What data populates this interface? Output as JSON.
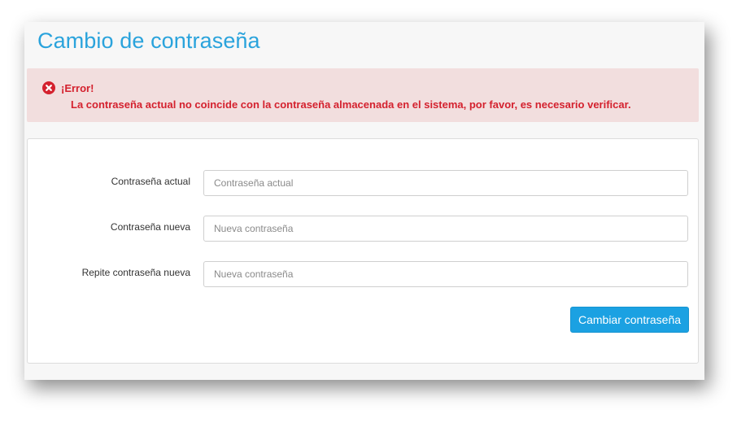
{
  "page": {
    "title": "Cambio de contraseña"
  },
  "alert": {
    "icon": "error-circle-icon",
    "title": "¡Error!",
    "message": "La contraseña actual no coincide con la contraseña almacenada en el sistema, por favor, es necesario verificar.",
    "color": "#d4212e",
    "background": "#f2dede"
  },
  "form": {
    "fields": [
      {
        "label": "Contraseña actual",
        "placeholder": "Contraseña actual",
        "value": ""
      },
      {
        "label": "Contraseña nueva",
        "placeholder": "Nueva contraseña",
        "value": ""
      },
      {
        "label": "Repite contraseña nueva",
        "placeholder": "Nueva contraseña",
        "value": ""
      }
    ],
    "submit_label": "Cambiar contraseña"
  },
  "colors": {
    "accent": "#2aa3dc",
    "button": "#1ba1e2"
  }
}
